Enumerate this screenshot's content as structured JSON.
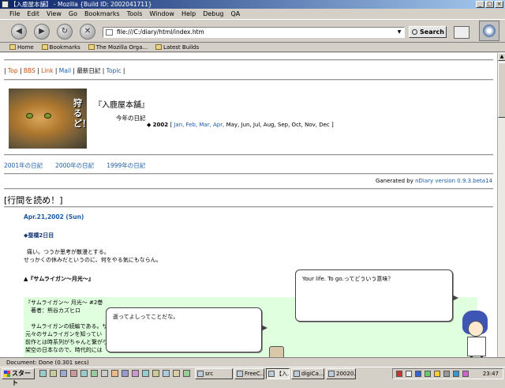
{
  "window": {
    "title": "【入鹿屋本舗】 - Mozilla {Build ID: 2002041711}"
  },
  "menu": [
    "File",
    "Edit",
    "View",
    "Go",
    "Bookmarks",
    "Tools",
    "Window",
    "Help",
    "Debug",
    "QA"
  ],
  "toolbar": {
    "url": "file:///C:/diary/html/index.htm",
    "search_label": "Search"
  },
  "personal_toolbar": [
    "Home",
    "Bookmarks",
    "The Mozilla Orga...",
    "Latest Builds"
  ],
  "page": {
    "topnav": {
      "sep": "|",
      "items": [
        "Top",
        "BBS",
        "Link",
        "Mail",
        "最新日記",
        "Topic"
      ]
    },
    "cat_text": "狩るど！",
    "site_title": "『入鹿屋本舗』",
    "diary_label": "今年の日記",
    "year": "2002",
    "linked_months": "Jan, Feb, Mar, Apr,",
    "other_months": "May, Jun, Jul, Aug, Sep, Oct, Nov, Dec",
    "year_links": [
      "2001年の日記",
      "2000年の日記",
      "1999年の日記"
    ],
    "generated_prefix": "Ganerated by ",
    "generated_link": "nDiary version 0.9.3.beta14",
    "section_heading": "[行間を読め！]",
    "entry_date": "Apr.21,2002 (Sun)",
    "sub_heading": "◆蚕橋2日目",
    "body_line1": "痛い。つうか思考が散漫とする。",
    "body_line2": "せっかくの休みだというのに、何をやる気にもならん。",
    "sub_heading2": "▲『サムライガン〜月光〜』",
    "green_lines": [
      "『サムライガン〜 月光〜 #2巻",
      "　著者：熊谷カズヒロ",
      "",
      "　サムライガンの続編である。サ",
      "元々のサムライガンを知ってい",
      "前作とは時系列がちゃんと繋がり",
      "架空の日本なので、時代的には"
    ]
  },
  "bubbles": {
    "top": "Your life. To go.ってどういう意味？",
    "bottom": "逝ってよしってことだな。"
  },
  "status": "Document: Done (0.301 secs)",
  "taskbar": {
    "start": "スタート",
    "tasks": [
      "src",
      "FreeC...",
      "【入...",
      "digiCa...",
      "20020..."
    ],
    "clock": "23:47"
  }
}
